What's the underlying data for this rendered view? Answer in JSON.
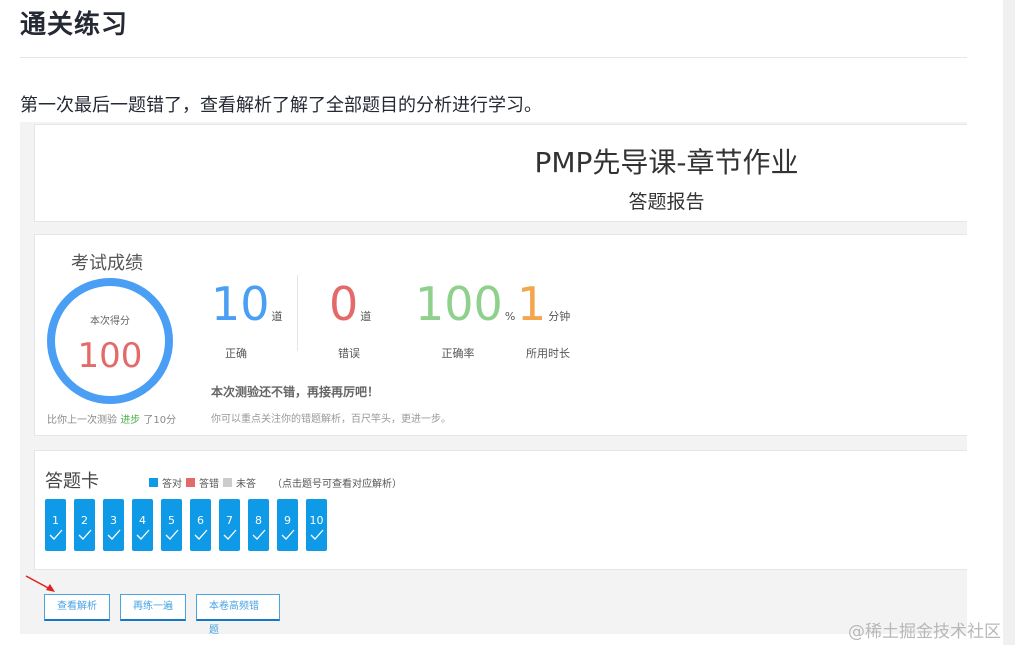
{
  "article": {
    "heading": "通关练习",
    "paragraph": "第一次最后一题错了，查看解析了解了全部题目的分析进行学习。"
  },
  "screenshot": {
    "title_panel": {
      "title": "PMP先导课-章节作业",
      "subtitle": "答题报告"
    },
    "score_panel": {
      "label": "考试成绩",
      "ring_caption": "本次得分",
      "score": "100",
      "score_fraction": 1.0,
      "compare_prefix": "比你上一次测验",
      "compare_highlight": "进步",
      "compare_suffix": "了10分",
      "stats": [
        {
          "value": "10",
          "unit": "道",
          "caption": "正确",
          "color": "#4a9ff5"
        },
        {
          "value": "0",
          "unit": "道",
          "caption": "错误",
          "color": "#e46a6a"
        },
        {
          "value": "100",
          "unit": "%",
          "caption": "正确率",
          "color": "#8fd18c"
        },
        {
          "value": "1",
          "unit": "分钟",
          "caption": "所用时长",
          "color": "#f3a64c"
        }
      ],
      "praise": "本次测验还不错，再接再厉吧！",
      "tip": "你可以重点关注你的错题解析，百尺竿头，更进一步。"
    },
    "answer_card": {
      "title": "答题卡",
      "legend": [
        {
          "label": "答对",
          "color": "#0e9ae6"
        },
        {
          "label": "答错",
          "color": "#e46a6a"
        },
        {
          "label": "未答",
          "color": "#cccccc"
        }
      ],
      "hint": "（点击题号可查看对应解析）",
      "questions": [
        "1",
        "2",
        "3",
        "4",
        "5",
        "6",
        "7",
        "8",
        "9",
        "10"
      ]
    },
    "actions": {
      "view_analysis": "查看解析",
      "retry": "再练一遍",
      "wrong_book": "本卷高频错题"
    }
  },
  "watermark": "@稀土掘金技术社区"
}
